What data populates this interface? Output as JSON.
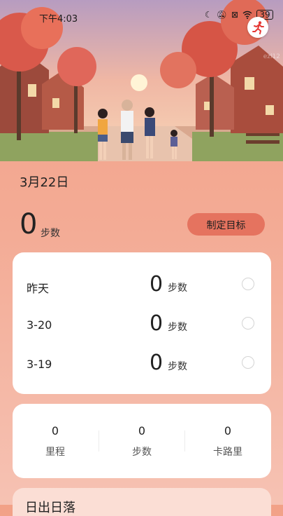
{
  "status_bar": {
    "time": "下午4:03",
    "battery": "39",
    "icons": [
      "moon-icon",
      "bell-off-icon",
      "sim-off-icon",
      "wifi-icon",
      "battery-icon"
    ]
  },
  "hero": {
    "watermark": "ezl12"
  },
  "summary": {
    "date": "3月22日",
    "steps": "0",
    "steps_unit": "步数",
    "goal_button": "制定目标"
  },
  "history": [
    {
      "label": "昨天",
      "value": "0",
      "unit": "步数"
    },
    {
      "label": "3-20",
      "value": "0",
      "unit": "步数"
    },
    {
      "label": "3-19",
      "value": "0",
      "unit": "步数"
    }
  ],
  "stats": [
    {
      "value": "0",
      "label": "里程"
    },
    {
      "value": "0",
      "label": "步数"
    },
    {
      "value": "0",
      "label": "卡路里"
    }
  ],
  "bottom_card": {
    "title": "日出日落"
  },
  "colors": {
    "accent": "#e5735f",
    "background_top": "#f2a187",
    "card": "#ffffff"
  }
}
